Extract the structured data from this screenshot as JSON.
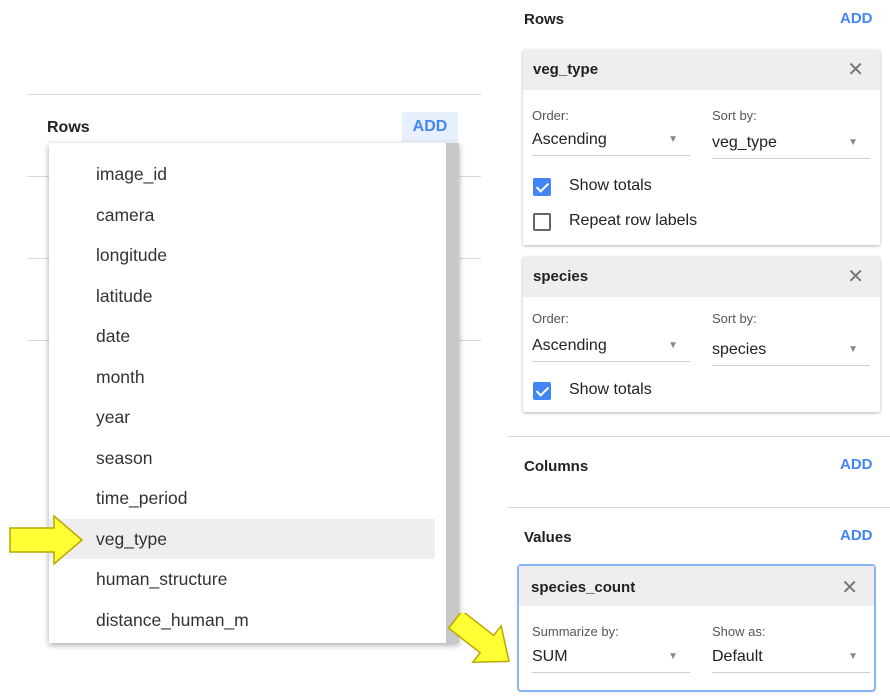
{
  "left": {
    "rows_label": "Rows",
    "add_label": "ADD",
    "dropdown_items": [
      {
        "label": "image_id"
      },
      {
        "label": "camera"
      },
      {
        "label": "longitude"
      },
      {
        "label": "latitude"
      },
      {
        "label": "date"
      },
      {
        "label": "month"
      },
      {
        "label": "year"
      },
      {
        "label": "season"
      },
      {
        "label": "time_period"
      },
      {
        "label": "veg_type",
        "highlighted": true
      },
      {
        "label": "human_structure"
      },
      {
        "label": "distance_human_m"
      }
    ]
  },
  "right": {
    "rows": {
      "label": "Rows",
      "add_label": "ADD",
      "cards": [
        {
          "title": "veg_type",
          "order_label": "Order:",
          "order_value": "Ascending",
          "sort_label": "Sort by:",
          "sort_value": "veg_type",
          "show_totals_label": "Show totals",
          "show_totals_checked": true,
          "repeat_labels_label": "Repeat row labels",
          "repeat_labels_checked": false
        },
        {
          "title": "species",
          "order_label": "Order:",
          "order_value": "Ascending",
          "sort_label": "Sort by:",
          "sort_value": "species",
          "show_totals_label": "Show totals",
          "show_totals_checked": true
        }
      ]
    },
    "columns": {
      "label": "Columns",
      "add_label": "ADD"
    },
    "values": {
      "label": "Values",
      "add_label": "ADD",
      "card": {
        "title": "species_count",
        "summarize_label": "Summarize by:",
        "summarize_value": "SUM",
        "show_as_label": "Show as:",
        "show_as_value": "Default"
      }
    }
  },
  "colors": {
    "accent": "#4285f4",
    "arrow_fill": "#ffff33",
    "highlight": "#eeeeee"
  }
}
